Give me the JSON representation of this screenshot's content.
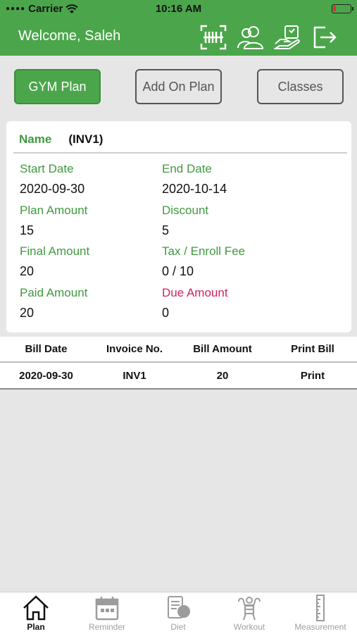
{
  "status_bar": {
    "carrier": "Carrier",
    "time": "10:16 AM"
  },
  "header": {
    "title": "Welcome, Saleh",
    "icons": [
      "barcode-scan-icon",
      "members-icon",
      "package-hand-icon",
      "logout-icon"
    ]
  },
  "plan_tabs": [
    "GYM Plan",
    "Add On Plan",
    "Classes"
  ],
  "plan_tabs_active": "GYM Plan",
  "plan": {
    "name_label": "Name",
    "name_value": "(INV1)",
    "start_date_label": "Start Date",
    "start_date": "2020-09-30",
    "end_date_label": "End Date",
    "end_date": "2020-10-14",
    "plan_amount_label": "Plan Amount",
    "plan_amount": "15",
    "discount_label": "Discount",
    "discount": "5",
    "final_amount_label": "Final Amount",
    "final_amount": "20",
    "tax_label": "Tax / Enroll Fee",
    "tax": "0 / 10",
    "paid_amount_label": "Paid Amount",
    "paid_amount": "20",
    "due_amount_label": "Due Amount",
    "due_amount": "0"
  },
  "bills": {
    "columns": [
      "Bill Date",
      "Invoice No.",
      "Bill Amount",
      "Print Bill"
    ],
    "rows": [
      [
        "2020-09-30",
        "INV1",
        "20",
        "Print"
      ]
    ]
  },
  "tab_bar": {
    "items": [
      "Plan",
      "Reminder",
      "Diet",
      "Workout",
      "Measurement"
    ],
    "active": "Plan"
  },
  "colors": {
    "brand_green": "#4ba64b",
    "label_green": "#3f9a3f",
    "due_pink": "#d0245a"
  }
}
